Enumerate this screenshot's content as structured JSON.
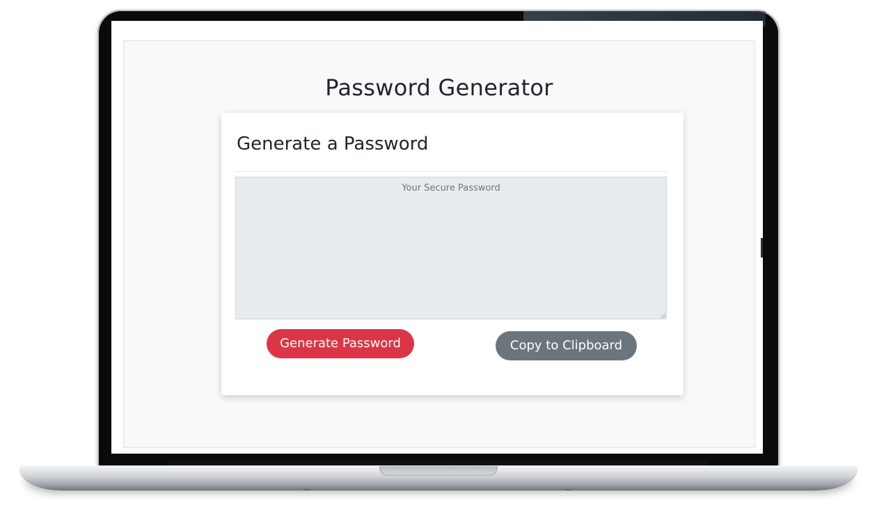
{
  "page": {
    "title": "Password Generator"
  },
  "card": {
    "header": "Generate a Password",
    "password_placeholder": "Your Secure Password",
    "password_value": ""
  },
  "buttons": {
    "generate_label": "Generate Password",
    "copy_label": "Copy to Clipboard"
  },
  "colors": {
    "generate_button": "#dc3545",
    "copy_button": "#6c757d",
    "page_background": "#f8f9fa",
    "textarea_background": "#e9ecef"
  }
}
